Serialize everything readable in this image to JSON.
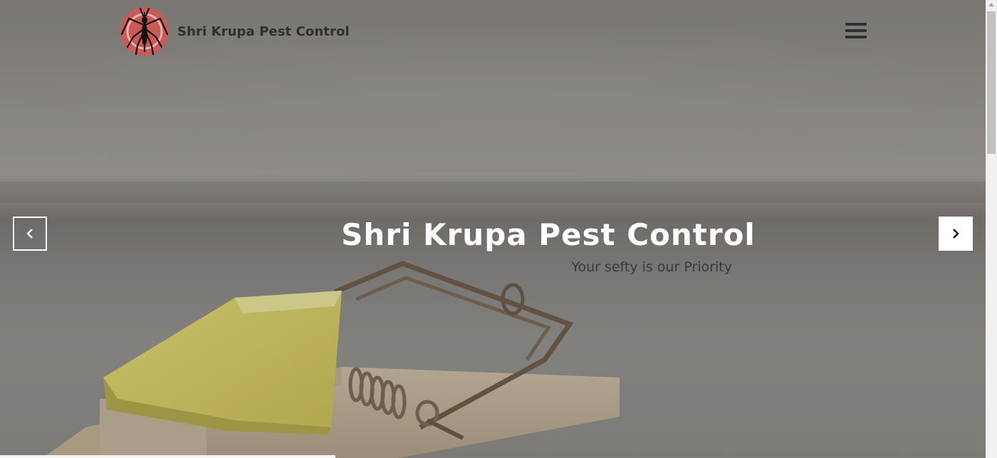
{
  "header": {
    "brand_name": "Shri Krupa Pest Control",
    "logo_icon": "mosquito-logo-icon",
    "menu_icon": "hamburger-menu-icon"
  },
  "slider": {
    "title": "Shri Krupa Pest Control",
    "subtitle": "Your sefty is our Priority",
    "prev_icon": "chevron-left-icon",
    "next_icon": "chevron-right-icon",
    "progress": 0.34
  },
  "colors": {
    "accent_red": "#d9534f",
    "title": "#ffffff",
    "brand_text": "#2f2f2f"
  }
}
